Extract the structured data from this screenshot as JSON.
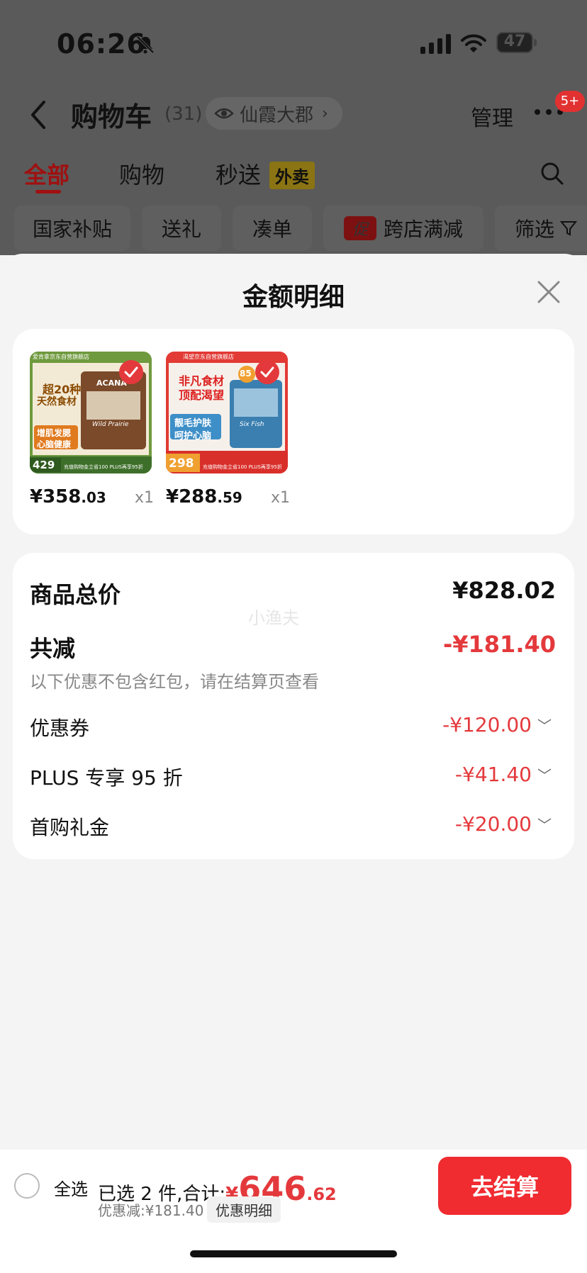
{
  "status_bar": {
    "time": "06:26",
    "battery": "47"
  },
  "header": {
    "title": "购物车",
    "count": "(31)",
    "location": "仙霞大郡",
    "manage": "管理",
    "badge": "5+"
  },
  "tabs": [
    {
      "label": "全部"
    },
    {
      "label": "购物"
    },
    {
      "label": "秒送"
    }
  ],
  "takeout_tag": "外卖",
  "chips": [
    {
      "label": "国家补贴"
    },
    {
      "label": "送礼"
    },
    {
      "label": "凑单"
    },
    {
      "label": "跨店满减"
    },
    {
      "label": "筛选"
    }
  ],
  "promo_tag": "促",
  "sheet": {
    "title": "金额明细"
  },
  "products": [
    {
      "price_int": "¥358",
      "price_dec": ".03",
      "qty": "x1",
      "art": {
        "store": "爱肯拿京东自营旗舰店",
        "headline1": "超20种",
        "headline2": "天然食材",
        "brand": "ACANA",
        "sub": "Wild Prairie",
        "feature1": "增肌发腮",
        "feature2": "心脑健康",
        "promo_price": "429",
        "promo_text": "充值购物金立省100 PLUS再享95折"
      }
    },
    {
      "price_int": "¥288",
      "price_dec": ".59",
      "qty": "x1",
      "art": {
        "store": "渴望京东自营旗舰店",
        "headline1": "非凡食材",
        "headline2": "顶配渴望",
        "badge": "85",
        "sub": "Six Fish",
        "feature1": "靓毛护肤",
        "feature2": "呵护心脑",
        "promo_price": "298",
        "promo_text": "充值购物金立省100 PLUS再享95折"
      }
    }
  ],
  "breakdown": {
    "total_label": "商品总价",
    "total_value": "¥828.02",
    "watermark": "小渔夫",
    "reduce_label": "共减",
    "reduce_value": "-¥181.40",
    "note": "以下优惠不包含红包，请在结算页查看",
    "items": [
      {
        "label": "优惠券",
        "value": "-¥120.00"
      },
      {
        "label": "PLUS 专享 95 折",
        "value": "-¥41.40"
      },
      {
        "label": "首购礼金",
        "value": "-¥20.00"
      }
    ]
  },
  "bottom": {
    "select_all": "全选",
    "selected_text": "已选 2 件,合计:",
    "yen": "¥",
    "total_int": "646",
    "total_dec": ".62",
    "discount": "优惠减:¥181.40",
    "detail_tag": "优惠明细",
    "checkout": "去结算"
  },
  "colors": {
    "accent": "#e4393c",
    "checkout": "#f02c31",
    "overlay": "#5a5a5a",
    "sheet": "#f4f4f4"
  }
}
